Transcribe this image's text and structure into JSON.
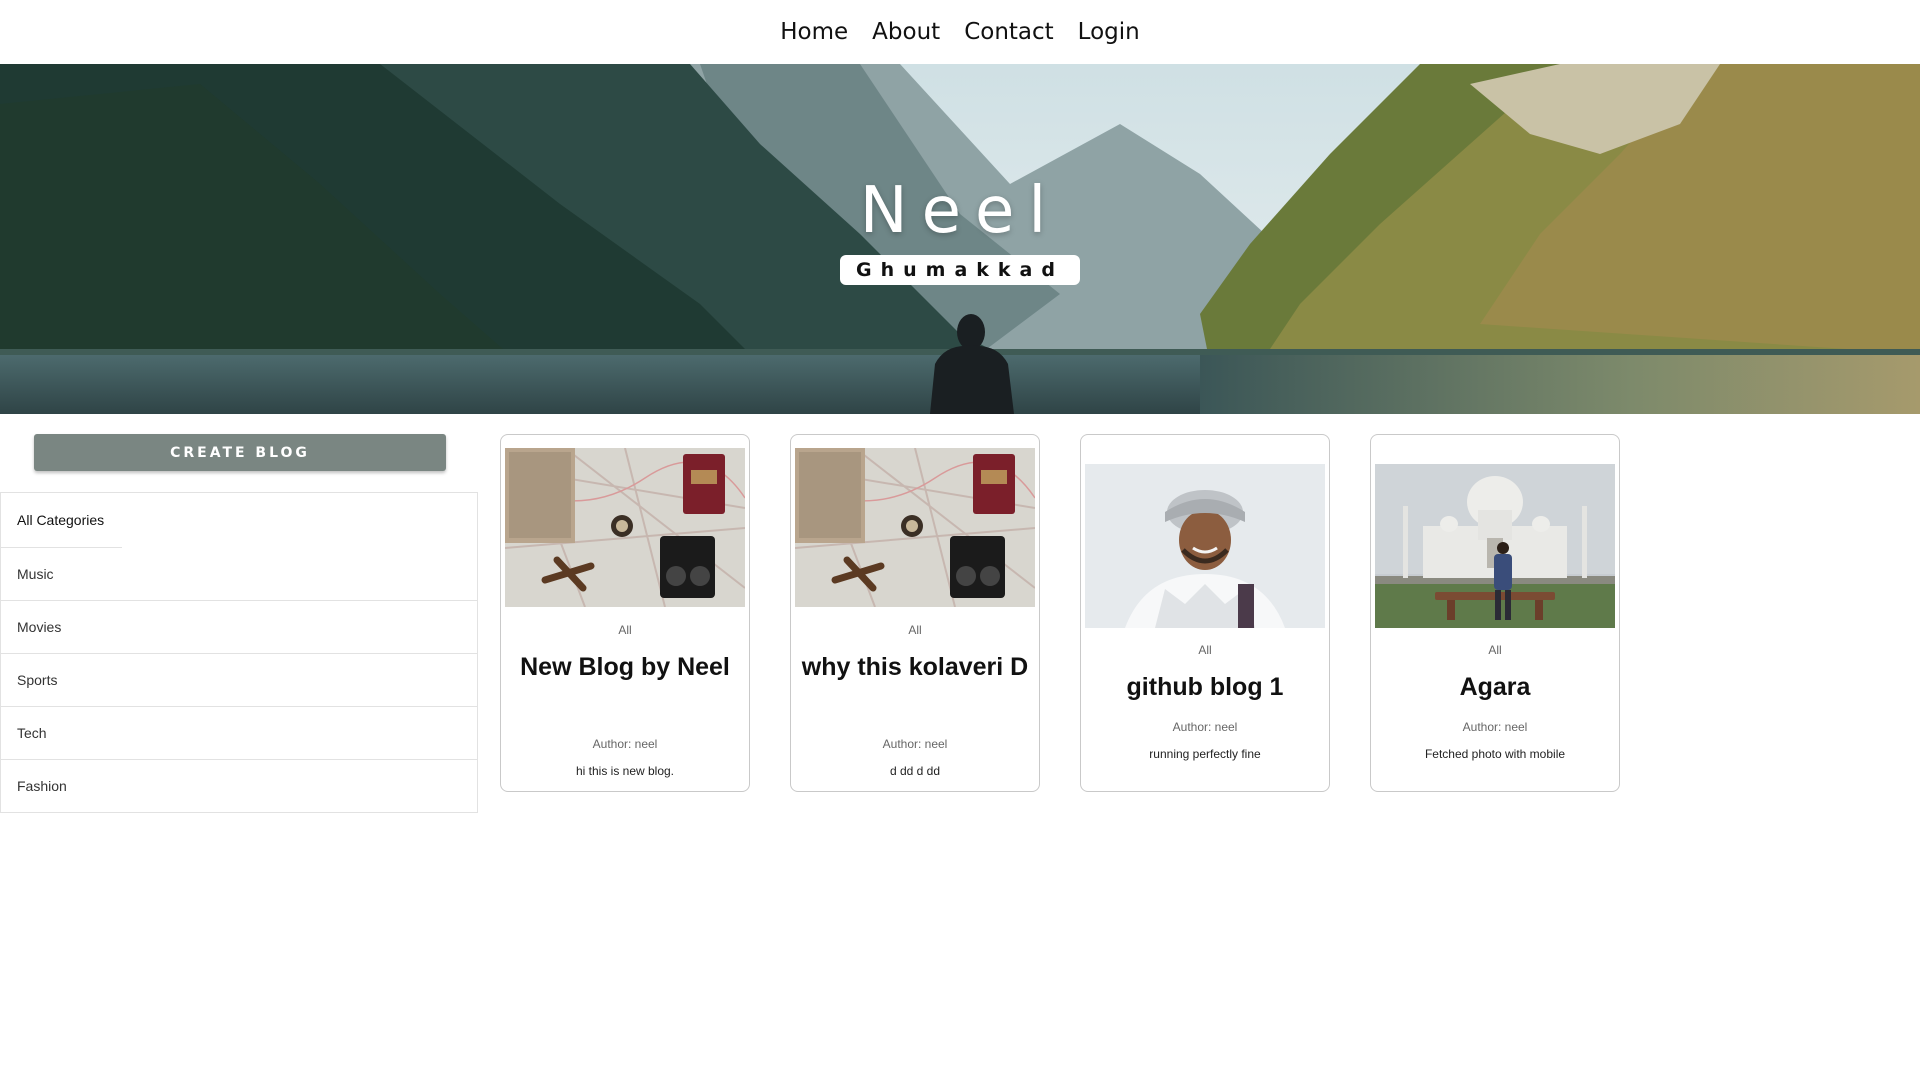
{
  "nav": {
    "items": [
      {
        "label": "Home"
      },
      {
        "label": "About"
      },
      {
        "label": "Contact"
      },
      {
        "label": "Login"
      }
    ]
  },
  "hero": {
    "title": "Neel",
    "subtitle": "Ghumakkad",
    "image": "mountain-lake-landscape"
  },
  "sidebar": {
    "create_label": "CREATE BLOG",
    "categories": [
      {
        "label": "All Categories"
      },
      {
        "label": "Music"
      },
      {
        "label": "Movies"
      },
      {
        "label": "Sports"
      },
      {
        "label": "Tech"
      },
      {
        "label": "Fashion"
      }
    ]
  },
  "posts": [
    {
      "category": "All",
      "title": "New Blog by Neel",
      "author": "Author: neel",
      "description": "hi this is new blog.",
      "image": "travel-flatlay-map-camera-passport"
    },
    {
      "category": "All",
      "title": "why this kolaveri D",
      "author": "Author: neel",
      "description": "d dd d dd",
      "image": "travel-flatlay-map-camera-passport"
    },
    {
      "category": "All",
      "title": "github blog 1",
      "author": "Author: neel",
      "description": "running perfectly fine",
      "image": "portrait-man-winter-jacket"
    },
    {
      "category": "All",
      "title": "Agara",
      "author": "Author: neel",
      "description": "Fetched photo with mobile",
      "image": "taj-mahal-person-sitting"
    }
  ],
  "colors": {
    "create_button": "#7a8682",
    "border": "#c9c9c9"
  }
}
